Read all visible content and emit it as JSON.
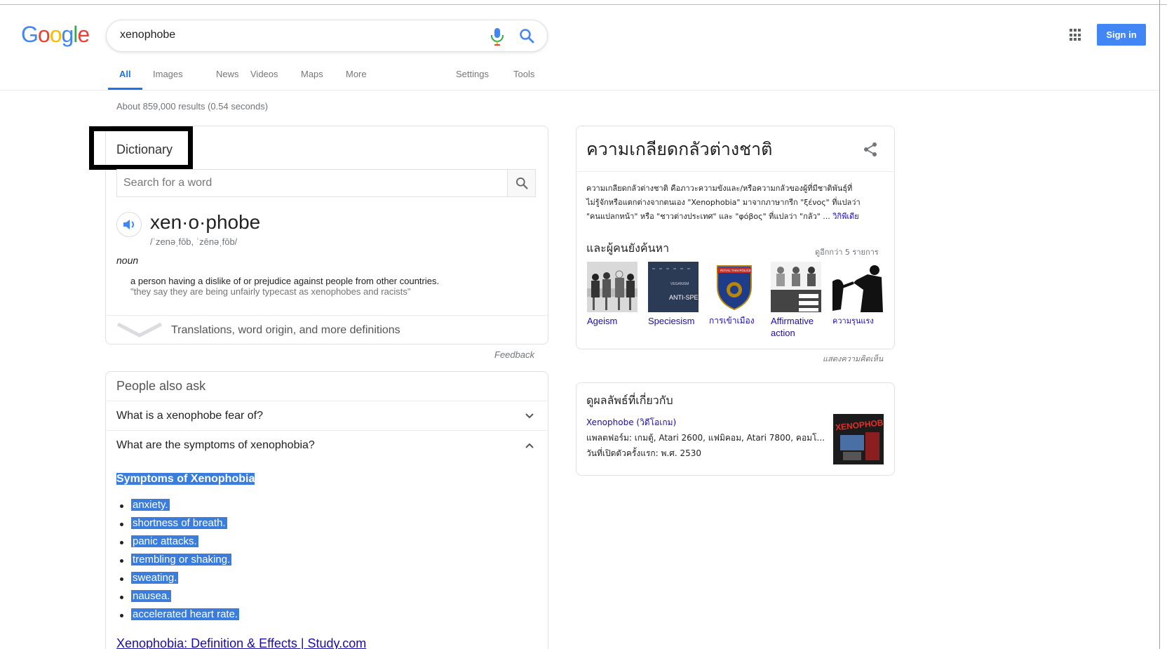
{
  "header": {
    "logo_letters": [
      "G",
      "o",
      "o",
      "g",
      "l",
      "e"
    ],
    "logo_colors": [
      "#4285f4",
      "#ea4335",
      "#fbbc05",
      "#4285f4",
      "#34a853",
      "#ea4335"
    ],
    "query": "xenophobe",
    "sign_in": "Sign in"
  },
  "tabs": {
    "items": [
      "All",
      "Images",
      "News",
      "Videos",
      "Maps",
      "More"
    ],
    "tools": [
      "Settings",
      "Tools"
    ],
    "active": "All"
  },
  "stats": "About 859,000 results (0.54 seconds)",
  "dictionary": {
    "title": "Dictionary",
    "search_placeholder": "Search for a word",
    "headword": "xen·o·phobe",
    "phonetic": "/ˈzenəˌfōb, ˈzēnəˌfōb/",
    "part_of_speech": "noun",
    "definition": "a person having a dislike of or prejudice against people from other countries.",
    "example": "\"they say they are being unfairly typecast as xenophobes and racists\"",
    "more_link": "Translations, word origin, and more definitions",
    "feedback": "Feedback"
  },
  "paa": {
    "title": "People also ask",
    "questions": [
      "What is a xenophobe fear of?",
      "What are the symptoms of xenophobia?"
    ],
    "answer_title": "Symptoms of Xenophobia",
    "answer_items": [
      "anxiety.",
      "shortness of breath.",
      "panic attacks.",
      "trembling or shaking.",
      "sweating.",
      "nausea.",
      "accelerated heart rate."
    ],
    "source_link": "Xenophobia: Definition & Effects | Study.com"
  },
  "knowledge_panel": {
    "title": "ความเกลียดกลัวต่างชาติ",
    "desc_lines": [
      "ความเกลียดกลัวต่างชาติ คือภาวะความขังและ/หรือความกลัวของผู้ที่มีชาติพันธุ์ที่",
      "ไม่รู้จักหรือแตกต่างจากตนเอง \"Xenophobia\" มาจากภาษากรีก \"ξένος\" ที่แปลว่า",
      "\"คนแปลกหน้า\" หรือ \"ชาวต่างประเทศ\" และ \"φόβος\" ที่แปลว่า \"กลัว\" ..."
    ],
    "wiki_link": "วิกิพีเดีย",
    "also_search_title": "และผู้คนยังค้นหา",
    "view_more": "ดูอีกกว่า 5 รายการ",
    "items": [
      "Ageism",
      "Speciesism",
      "การเข้าเมือง",
      "Affirmative action",
      "ความรุนแรง"
    ],
    "thumb2_text": "ANTI-SPEC",
    "thumb2_small": "VEGANISM",
    "thumb3_text": "ROYAL THAI POLICE",
    "feedback": "แสดงความคิดเห็น"
  },
  "related": {
    "title": "ดูผลลัพธ์ที่เกี่ยวกับ",
    "link": "Xenophobe (วิดีโอเกม)",
    "platform": "แพลตฟอร์ม: เกมตู้, Atari 2600, แฟมิคอม, Atari 7800, คอมโ...",
    "release": "วันที่เปิดตัวครั้งแรก: พ.ศ. 2530",
    "image_text": "XENOPHOBE"
  }
}
